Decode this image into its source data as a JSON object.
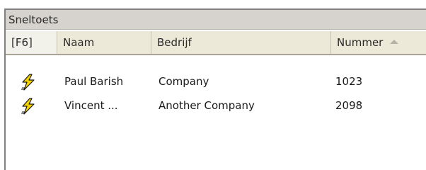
{
  "section": {
    "title": "Sneltoets"
  },
  "columns": {
    "key": "[F6]",
    "name": "Naam",
    "company": "Bedrijf",
    "number": "Nummer"
  },
  "rows": [
    {
      "icon": "lightning-hotkey-icon",
      "name": "Paul Barish",
      "company": "Company",
      "number": "1023"
    },
    {
      "icon": "lightning-hotkey-icon",
      "name": "Vincent ...",
      "company": "Another Company",
      "number": "2098"
    }
  ],
  "colors": {
    "header_bg": "#ece9d8",
    "title_bg": "#d6d3ce",
    "icon_yellow": "#f5d400"
  }
}
